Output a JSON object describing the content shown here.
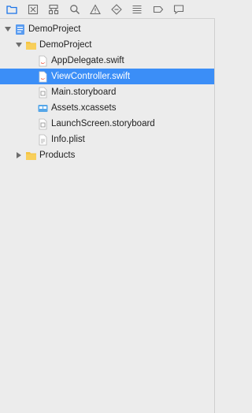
{
  "toolbar": {
    "icons": [
      "folder-icon",
      "source-control-icon",
      "hierarchy-icon",
      "search-icon",
      "warning-icon",
      "breakpoint-diamond-icon",
      "list-icon",
      "tag-icon",
      "comment-icon"
    ]
  },
  "tree": {
    "project": {
      "label": "DemoProject"
    },
    "group": {
      "label": "DemoProject"
    },
    "files": [
      {
        "label": "AppDelegate.swift",
        "kind": "swift"
      },
      {
        "label": "ViewController.swift",
        "kind": "swift"
      },
      {
        "label": "Main.storyboard",
        "kind": "storyboard"
      },
      {
        "label": "Assets.xcassets",
        "kind": "assets"
      },
      {
        "label": "LaunchScreen.storyboard",
        "kind": "storyboard"
      },
      {
        "label": "Info.plist",
        "kind": "plist"
      }
    ],
    "products": {
      "label": "Products"
    }
  },
  "colors": {
    "selection": "#3b8ef7",
    "folder": "#f5c342",
    "accent": "#1a73e8"
  }
}
